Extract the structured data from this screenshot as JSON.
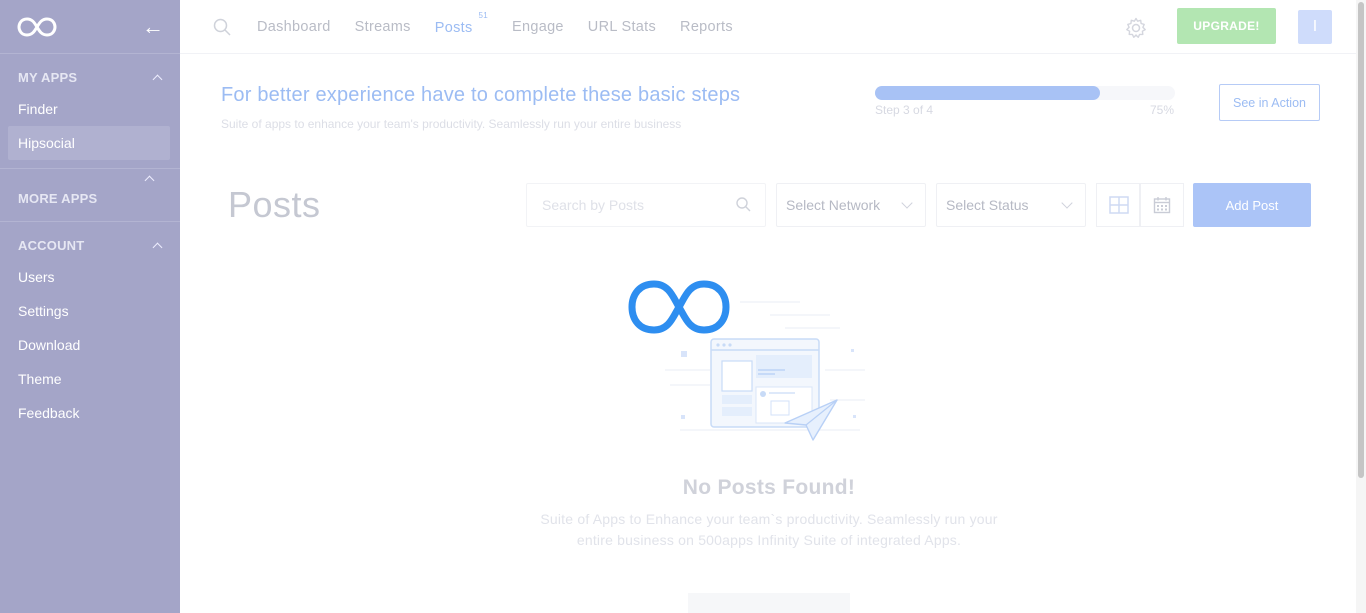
{
  "sidebar": {
    "sections": [
      {
        "title": "MY APPS",
        "items": [
          {
            "label": "Finder"
          },
          {
            "label": "Hipsocial"
          }
        ]
      },
      {
        "title": "MORE APPS",
        "items": []
      },
      {
        "title": "ACCOUNT",
        "items": [
          {
            "label": "Users"
          },
          {
            "label": "Settings"
          },
          {
            "label": "Download"
          },
          {
            "label": "Theme"
          },
          {
            "label": "Feedback"
          }
        ]
      }
    ]
  },
  "topnav": {
    "items": [
      {
        "label": "Dashboard"
      },
      {
        "label": "Streams"
      },
      {
        "label": "Posts",
        "badge": "51"
      },
      {
        "label": "Engage"
      },
      {
        "label": "URL Stats"
      },
      {
        "label": "Reports"
      }
    ],
    "upgrade_label": "UPGRADE!",
    "avatar_initial": "I"
  },
  "steps": {
    "title": "For better experience have to complete these basic steps",
    "subtitle": "Suite of apps to enhance your team's productivity. Seamlessly run your entire business",
    "progress_label": "Step 3 of 4",
    "progress_percent": "75%",
    "progress_value": 0.75,
    "see_action_label": "See in Action"
  },
  "posts": {
    "title": "Posts",
    "search_placeholder": "Search by Posts",
    "network_select": "Select Network",
    "status_select": "Select Status",
    "add_post_label": "Add Post"
  },
  "empty": {
    "title": "No Posts Found!",
    "line1": "Suite of Apps to Enhance your team`s productivity. Seamlessly run your",
    "line2": "entire business on 500apps Infinity Suite of integrated Apps."
  },
  "colors": {
    "sidebar": "#a4a5c8",
    "accent": "#9cbcf3",
    "upgrade": "#b3e6b2",
    "logo_blue": "#2e8ef0"
  }
}
